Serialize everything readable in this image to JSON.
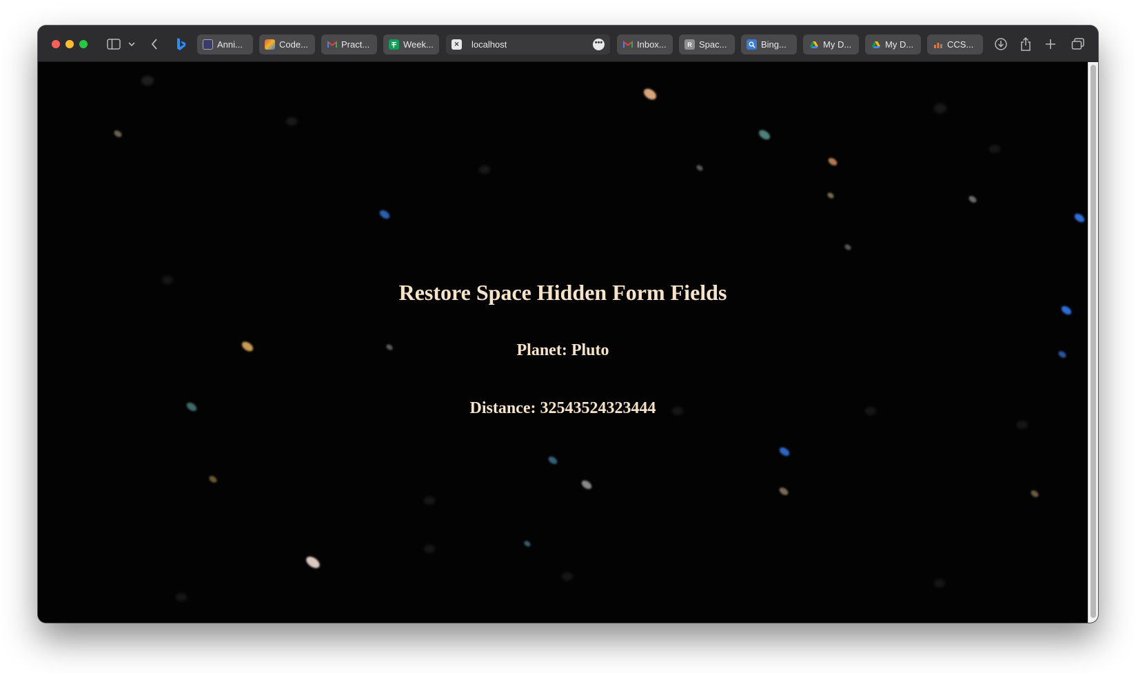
{
  "browser": {
    "tabs": [
      {
        "label": "Anni...",
        "icon": "doc-thumbnail-icon",
        "color": "#3b3b6b"
      },
      {
        "label": "Code...",
        "icon": "codepen-colorful-icon",
        "color": "#e2583e"
      },
      {
        "label": "Pract...",
        "icon": "gmail-icon",
        "color": "#ea4335"
      },
      {
        "label": "Week...",
        "icon": "sheets-icon",
        "color": "#0f9d58"
      },
      {
        "label": "localhost",
        "icon": "close-icon",
        "color": "#ffffff",
        "active": true
      },
      {
        "label": "Inbox...",
        "icon": "gmail-icon",
        "color": "#ea4335"
      },
      {
        "label": "Spac...",
        "icon": "r-letter-icon",
        "color": "#8e8e93",
        "letter": "R"
      },
      {
        "label": "Bing...",
        "icon": "search-icon",
        "color": "#3a7bd5"
      },
      {
        "label": "My D...",
        "icon": "google-drive-icon",
        "color": "#fbbc04"
      },
      {
        "label": "My D...",
        "icon": "google-drive-icon",
        "color": "#fbbc04"
      },
      {
        "label": "CCS...",
        "icon": "ccs-icon",
        "color": "#f37021"
      }
    ],
    "more_button": "•••"
  },
  "page": {
    "title": "Restore Space Hidden Form Fields",
    "planet": "Planet: Pluto",
    "distance": "Distance: 32543524323444"
  }
}
